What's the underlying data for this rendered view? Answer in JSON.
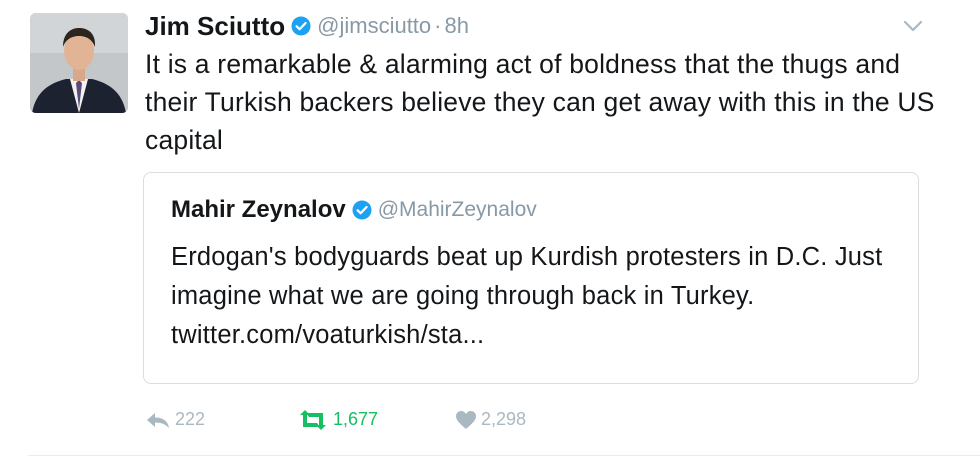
{
  "tweet": {
    "author_name": "Jim Sciutto",
    "handle": "@jimsciutto",
    "separator": "·",
    "time": "8h",
    "text": "It is a remarkable & alarming act of boldness that the thugs and their Turkish backers believe they can get away with this in the US capital"
  },
  "quoted": {
    "author_name": "Mahir Zeynalov",
    "handle": "@MahirZeynalov",
    "text": "Erdogan's bodyguards beat up Kurdish protesters in D.C. Just imagine what we are going through back in Turkey. twitter.com/voaturkish/sta..."
  },
  "actions": {
    "reply_count": "222",
    "retweet_count": "1,677",
    "like_count": "2,298"
  },
  "icons": {
    "verified": "verified-badge-icon",
    "chevron": "chevron-down-icon",
    "reply": "reply-icon",
    "retweet": "retweet-icon",
    "like": "heart-icon"
  },
  "colors": {
    "verified": "#1da1f2",
    "muted": "#8899a6",
    "retweet_active": "#17bf63",
    "action_icon": "#aab8c2"
  }
}
